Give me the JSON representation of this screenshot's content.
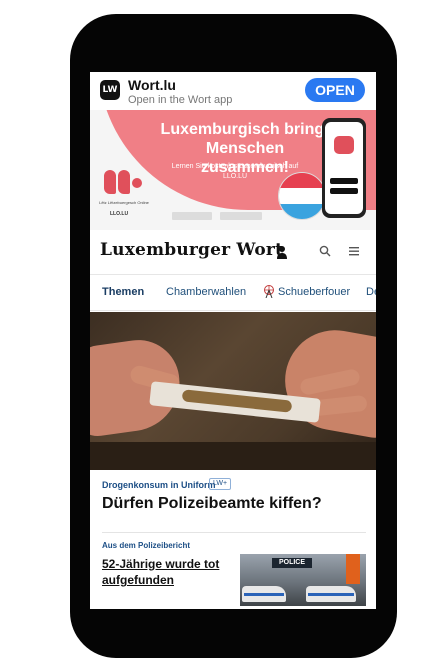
{
  "app_banner": {
    "icon_text": "LW",
    "app_name": "Wort.lu",
    "subtitle": "Open in the Wort app",
    "open_label": "OPEN",
    "accent_color": "#2a79f1"
  },
  "ad": {
    "headline": "Luxemburgisch bringt Menschen zusammen!",
    "subline": "Lernen Sie kostenlos Luxemburgisch auf LLO.LU",
    "logo_caption": "Lëtz Lëtzebuergesch Online",
    "logo_name": "LLO.LU",
    "bg_color": "#f07f86"
  },
  "masthead": {
    "logo": "Luxemburger Wort"
  },
  "nav": {
    "items": [
      {
        "label": "Themen",
        "active": true
      },
      {
        "label": "Chamberwahlen",
        "active": false
      },
      {
        "label": "Schueberfouer",
        "active": false
      },
      {
        "label": "De",
        "active": false
      }
    ]
  },
  "article_main": {
    "kicker": "Drogenkonsum in Uniform",
    "badge": "LW+",
    "headline": "Dürfen Polizeibeamte kiffen?"
  },
  "article_secondary": {
    "kicker": "Aus dem Polizeibericht",
    "headline": "52-Jährige wurde tot aufgefunden",
    "thumb_sign": "POLICE"
  }
}
